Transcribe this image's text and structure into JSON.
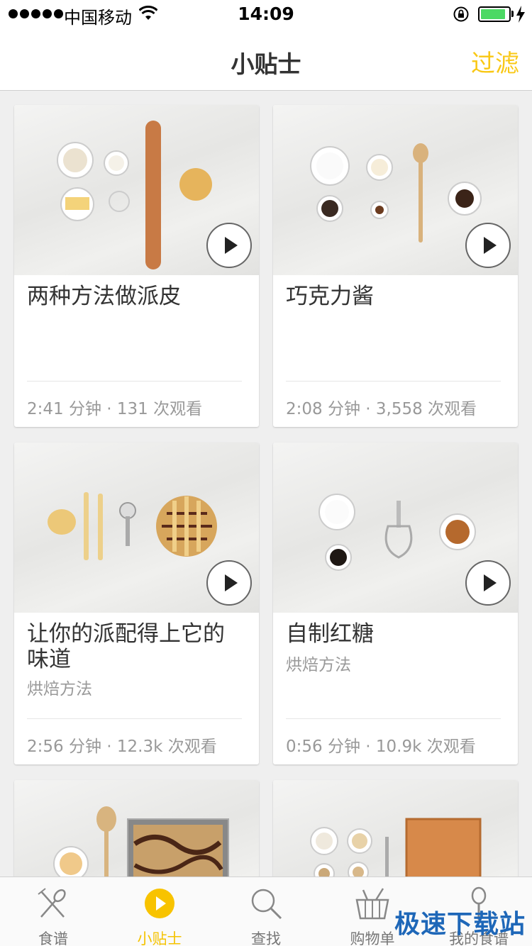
{
  "status_bar": {
    "carrier": "中国移动",
    "time": "14:09",
    "battery_level": 0.9
  },
  "nav": {
    "title": "小贴士",
    "filter_label": "过滤"
  },
  "cards": [
    {
      "title": "两种方法做派皮",
      "subtitle": "",
      "meta": "2:41 分钟 · 131 次观看"
    },
    {
      "title": "巧克力酱",
      "subtitle": "",
      "meta": "2:08 分钟 · 3,558 次观看"
    },
    {
      "title": "让你的派配得上它的味道",
      "subtitle": "烘焙方法",
      "meta": "2:56 分钟 · 12.3k 次观看"
    },
    {
      "title": "自制红糖",
      "subtitle": "烘焙方法",
      "meta": "0:56 分钟 · 10.9k 次观看"
    }
  ],
  "tabs": [
    {
      "label": "食谱",
      "icon": "fork-spoon-icon",
      "active": false
    },
    {
      "label": "小贴士",
      "icon": "play-circle-icon",
      "active": true
    },
    {
      "label": "查找",
      "icon": "search-icon",
      "active": false
    },
    {
      "label": "购物单",
      "icon": "basket-icon",
      "active": false
    },
    {
      "label": "我的食谱",
      "icon": "spoon-icon",
      "active": false
    }
  ],
  "colors": {
    "accent": "#f9c815",
    "background": "#efefef",
    "text": "#333333",
    "muted": "#999999"
  },
  "watermark": "极速下载站"
}
